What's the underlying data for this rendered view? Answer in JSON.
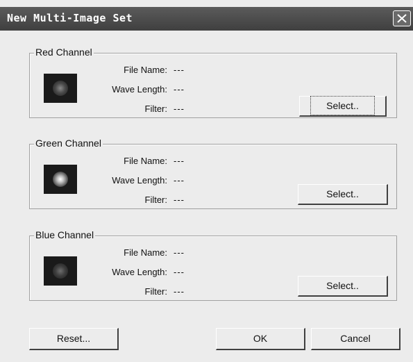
{
  "window": {
    "title": "New Multi-Image Set"
  },
  "labels": {
    "file_name": "File Name:",
    "wave_length": "Wave Length:",
    "filter": "Filter:"
  },
  "channels": [
    {
      "name": "Red Channel",
      "file_name": "---",
      "wave_length": "---",
      "filter": "---",
      "select_label": "Select.."
    },
    {
      "name": "Green Channel",
      "file_name": "---",
      "wave_length": "---",
      "filter": "---",
      "select_label": "Select.."
    },
    {
      "name": "Blue Channel",
      "file_name": "---",
      "wave_length": "---",
      "filter": "---",
      "select_label": "Select.."
    }
  ],
  "buttons": {
    "reset": "Reset...",
    "ok": "OK",
    "cancel": "Cancel"
  },
  "icons": {
    "close": "close-icon"
  }
}
